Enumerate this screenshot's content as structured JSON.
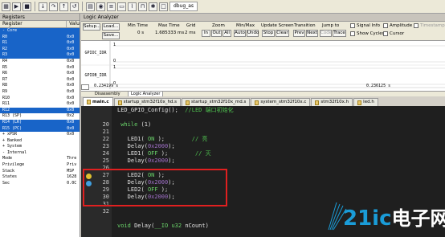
{
  "toolbar": {
    "tab_label": "dbug_as",
    "buttons": [
      "select-icon",
      "run-icon",
      "stop-icon",
      "step-icon",
      "step-over-icon",
      "step-out-icon",
      "reset-icon",
      "memory-icon",
      "watch-icon",
      "register-icon",
      "serial-icon",
      "trace-icon",
      "logic-icon",
      "settings-icon",
      "window-icon"
    ]
  },
  "registers": {
    "title": "Registers",
    "col_register": "Register",
    "col_value": "Valu",
    "rows": [
      {
        "name": "- Core",
        "value": "",
        "sel": true
      },
      {
        "name": "    R0",
        "value": "0x0",
        "sel": true
      },
      {
        "name": "    R1",
        "value": "0x0",
        "sel": true
      },
      {
        "name": "    R2",
        "value": "0x0",
        "sel": true
      },
      {
        "name": "    R3",
        "value": "0x0",
        "sel": true
      },
      {
        "name": "    R4",
        "value": "0x0",
        "sel": false
      },
      {
        "name": "    R5",
        "value": "0x0",
        "sel": false
      },
      {
        "name": "    R6",
        "value": "0x0",
        "sel": false
      },
      {
        "name": "    R7",
        "value": "0x0",
        "sel": false
      },
      {
        "name": "    R8",
        "value": "0x0",
        "sel": false
      },
      {
        "name": "    R9",
        "value": "0x0",
        "sel": false
      },
      {
        "name": "    R10",
        "value": "0x0",
        "sel": false
      },
      {
        "name": "    R11",
        "value": "0x0",
        "sel": false
      },
      {
        "name": "    R12",
        "value": "0x0",
        "sel": true
      },
      {
        "name": "    R13 (SP)",
        "value": "0x2",
        "sel": false
      },
      {
        "name": "    R14 (LR)",
        "value": "0x0",
        "sel": true
      },
      {
        "name": "    R15 (PC)",
        "value": "0x0",
        "sel": true
      },
      {
        "name": "  + xPSR",
        "value": "0x0",
        "sel": false
      },
      {
        "name": "+ Banked",
        "value": "",
        "sel": false
      },
      {
        "name": "+ System",
        "value": "",
        "sel": false
      },
      {
        "name": "- Internal",
        "value": "",
        "sel": false
      },
      {
        "name": "    Mode",
        "value": "Thre",
        "sel": false
      },
      {
        "name": "    Privilege",
        "value": "Priv",
        "sel": false
      },
      {
        "name": "    Stack",
        "value": "MSP",
        "sel": false
      },
      {
        "name": "    States",
        "value": "1628",
        "sel": false
      },
      {
        "name": "    Sec",
        "value": "0.0C",
        "sel": false
      }
    ]
  },
  "logic_analyzer": {
    "title": "Logic Analyzer",
    "setup_label": "Setup...",
    "load_label": "Load...",
    "save_label": "Save...",
    "min_time_label": "Min Time",
    "min_time_value": "0 s",
    "max_time_label": "Max Time",
    "max_time_value": "1.685333 ms",
    "grid_label": "Grid",
    "grid_value": "2 ms",
    "zoom_label": "Zoom",
    "zoom_in": "In",
    "zoom_out": "Out",
    "zoom_all": "All",
    "minmax_label": "Min/Max",
    "auto_label": "Auto",
    "undo_label": "Undo",
    "update_label": "Update Screen",
    "stop_label": "Stop",
    "clear_label": "Clear",
    "transition_label": "Transition",
    "prev_label": "Prev",
    "next_label": "Next",
    "jumpto_label": "Jump to",
    "code_label": "Code",
    "trace_label": "Trace",
    "signal_info": "Signal Info",
    "show_cycles": "Show Cycles",
    "amplitude": "Amplitude",
    "cursor": "Cursor",
    "timestamps": "Timestamps",
    "signal1": "GPIOC_IDR",
    "signal2": "GPIOB_IDR",
    "sig1_level1": "1",
    "sig1_level0": "0",
    "sig2_level1": "1",
    "sig2_level0": "0",
    "time_left": "0.234199 s",
    "time_right": "0.236125 s",
    "tab_disassembly": "Disassembly",
    "tab_logic": "Logic Analyzer"
  },
  "editor_tabs": [
    {
      "label": "main.c",
      "active": true
    },
    {
      "label": "startup_stm32f10x_hd.s",
      "active": false
    },
    {
      "label": "startup_stm32f10x_md.s",
      "active": false
    },
    {
      "label": "system_stm32f10x.c",
      "active": false
    },
    {
      "label": "stm32f10x.h",
      "active": false
    },
    {
      "label": "led.h",
      "active": false
    }
  ],
  "code": {
    "lines": [
      {
        "no": "",
        "text": "LED_GPIO_Config();  //LED 端口初始化"
      },
      {
        "no": "",
        "text": ""
      },
      {
        "no": "",
        "text": " while (1)"
      },
      {
        "no": "",
        "text": ""
      },
      {
        "no": "",
        "text": "   LED1( ON );        // 亮"
      },
      {
        "no": "",
        "text": "   Delay(0x2000);"
      },
      {
        "no": "",
        "text": "   LED1( OFF );        // 灭"
      },
      {
        "no": "",
        "text": "   Delay(0x2000);"
      },
      {
        "no": "26",
        "text": ""
      },
      {
        "no": "27",
        "text": "   LED2( ON );"
      },
      {
        "no": "28",
        "text": "   Delay(0x2000);"
      },
      {
        "no": "29",
        "text": "   LED2( OFF );"
      },
      {
        "no": "30",
        "text": "   Delay(0x2000);"
      },
      {
        "no": "31",
        "text": ""
      },
      {
        "no": "32",
        "text": ""
      },
      {
        "no": "",
        "text": ""
      },
      {
        "no": "",
        "text": "void Delay(__IO u32 nCount)"
      }
    ],
    "numbers_upper": [
      "20",
      "21",
      "22",
      "23",
      "24",
      "25"
    ]
  },
  "watermark": {
    "text": "21ic 电子网",
    "brand_color": "#1a9cd8"
  }
}
